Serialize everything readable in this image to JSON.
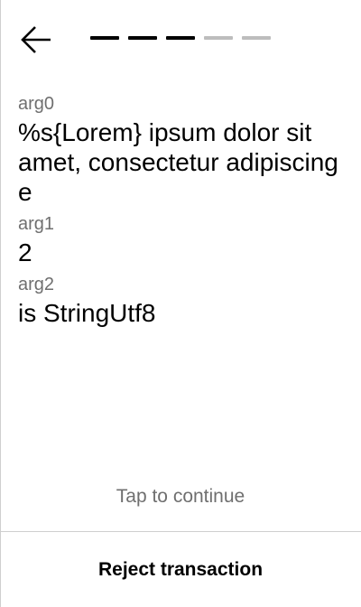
{
  "header": {
    "back_icon": "arrow-left-icon",
    "progress": {
      "total_steps": 5,
      "current_step": 3,
      "active_color": "#000000",
      "inactive_color": "#bdbdbd"
    }
  },
  "fields": [
    {
      "label": "arg0",
      "value": "%s{Lorem} ipsum dolor sit amet, consectetur adipiscing e"
    },
    {
      "label": "arg1",
      "value": "2"
    },
    {
      "label": "arg2",
      "value": "is StringUtf8"
    }
  ],
  "tap_continue": "Tap to continue",
  "footer": {
    "reject_label": "Reject transaction"
  }
}
